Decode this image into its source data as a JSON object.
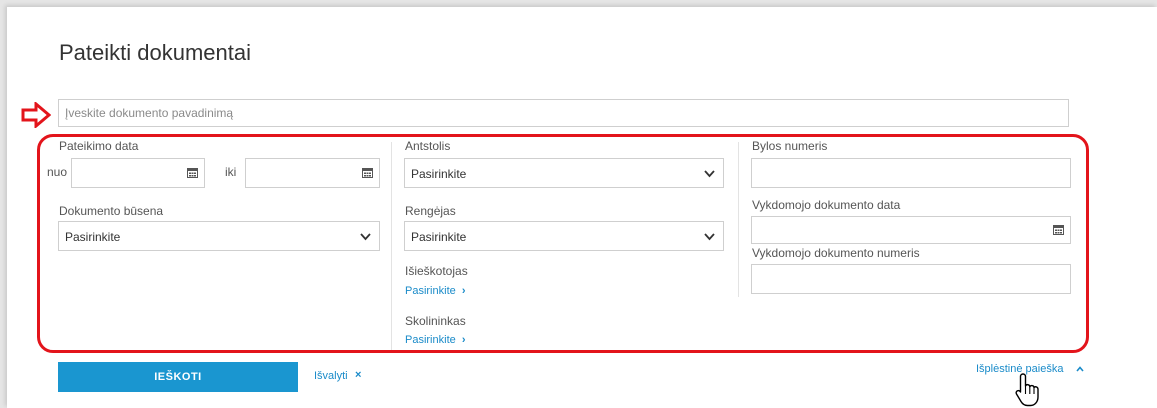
{
  "page": {
    "title": "Pateikti dokumentai"
  },
  "search": {
    "placeholder": "Įveskite dokumento pavadinimą"
  },
  "filters": {
    "submission_date": {
      "label": "Pateikimo data",
      "from_label": "nuo",
      "to_label": "iki"
    },
    "document_status": {
      "label": "Dokumento būsena",
      "value": "Pasirinkite"
    },
    "bailiff": {
      "label": "Antstolis",
      "value": "Pasirinkite"
    },
    "preparer": {
      "label": "Rengėjas",
      "value": "Pasirinkite"
    },
    "recoverer": {
      "label": "Išieškotojas",
      "link": "Pasirinkite"
    },
    "debtor": {
      "label": "Skolininkas",
      "link": "Pasirinkite"
    },
    "case_number": {
      "label": "Bylos numeris"
    },
    "enforcement_doc_date": {
      "label": "Vykdomojo dokumento data"
    },
    "enforcement_doc_number": {
      "label": "Vykdomojo dokumento numeris"
    }
  },
  "actions": {
    "search_label": "IEŠKOTI",
    "clear_label": "Išvalyti",
    "clear_icon": "×",
    "advanced_label": "Išplėstinė paieška",
    "link_chevron": "›"
  },
  "colors": {
    "accent": "#1a96d0",
    "link": "#1a8bc9",
    "highlight": "#e3141b"
  }
}
